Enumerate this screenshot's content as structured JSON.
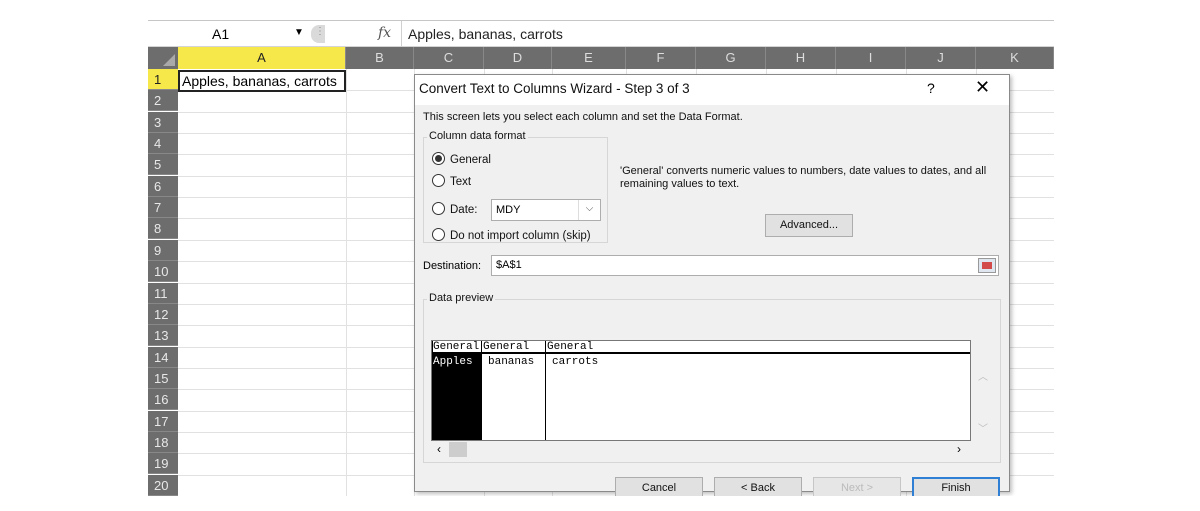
{
  "namebox": {
    "value": "A1",
    "arrow": "▼"
  },
  "formula": {
    "fx": "fx",
    "value": "Apples, bananas, carrots"
  },
  "columns": [
    "A",
    "B",
    "C",
    "D",
    "E",
    "F",
    "G",
    "H",
    "I",
    "J",
    "K"
  ],
  "rows": [
    "1",
    "2",
    "3",
    "4",
    "5",
    "6",
    "7",
    "8",
    "9",
    "10",
    "11",
    "12",
    "13",
    "14",
    "15",
    "16",
    "17",
    "18",
    "19",
    "20"
  ],
  "cell_a1": "Apples, bananas, carrots",
  "dialog": {
    "title": "Convert Text to Columns Wizard - Step 3 of 3",
    "help": "?",
    "close": "✕",
    "intro": "This screen lets you select each column and set the Data Format.",
    "group_label": "Column data format",
    "radios": {
      "general": "General",
      "text": "Text",
      "date": "Date:",
      "skip": "Do not import column (skip)"
    },
    "radio_selected": "general",
    "date_format": "MDY",
    "description": "'General' converts numeric values to numbers, date values to dates, and all remaining values to text.",
    "advanced": "Advanced...",
    "destination_label": "Destination:",
    "destination_value": "$A$1",
    "preview_label": "Data preview",
    "preview": {
      "headers": [
        "General",
        "General",
        "General"
      ],
      "values": [
        "Apples",
        "bananas",
        "carrots"
      ]
    },
    "buttons": {
      "cancel": "Cancel",
      "back": "< Back",
      "next": "Next >",
      "finish": "Finish"
    }
  }
}
